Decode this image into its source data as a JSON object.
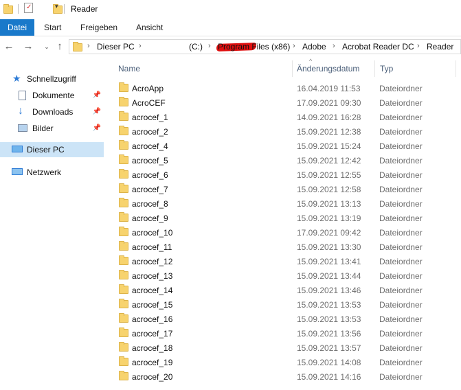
{
  "window": {
    "title": "Reader"
  },
  "ribbon": {
    "tabs": [
      "Datei",
      "Start",
      "Freigeben",
      "Ansicht"
    ]
  },
  "address": {
    "crumbs": [
      "Dieser PC",
      "(C:)",
      "Program Files (x86)",
      "Adobe",
      "Acrobat Reader DC",
      "Reader"
    ]
  },
  "sidebar": {
    "quick_access": "Schnellzugriff",
    "items": [
      "Dokumente",
      "Downloads",
      "Bilder"
    ],
    "this_pc": "Dieser PC",
    "network": "Netzwerk"
  },
  "columns": {
    "name": "Name",
    "date": "Änderungsdatum",
    "type": "Typ"
  },
  "files": [
    {
      "name": "AcroApp",
      "date": "16.04.2019 11:53",
      "type": "Dateiordner"
    },
    {
      "name": "AcroCEF",
      "date": "17.09.2021 09:30",
      "type": "Dateiordner"
    },
    {
      "name": "acrocef_1",
      "date": "14.09.2021 16:28",
      "type": "Dateiordner"
    },
    {
      "name": "acrocef_2",
      "date": "15.09.2021 12:38",
      "type": "Dateiordner"
    },
    {
      "name": "acrocef_4",
      "date": "15.09.2021 15:24",
      "type": "Dateiordner"
    },
    {
      "name": "acrocef_5",
      "date": "15.09.2021 12:42",
      "type": "Dateiordner"
    },
    {
      "name": "acrocef_6",
      "date": "15.09.2021 12:55",
      "type": "Dateiordner"
    },
    {
      "name": "acrocef_7",
      "date": "15.09.2021 12:58",
      "type": "Dateiordner"
    },
    {
      "name": "acrocef_8",
      "date": "15.09.2021 13:13",
      "type": "Dateiordner"
    },
    {
      "name": "acrocef_9",
      "date": "15.09.2021 13:19",
      "type": "Dateiordner"
    },
    {
      "name": "acrocef_10",
      "date": "17.09.2021 09:42",
      "type": "Dateiordner"
    },
    {
      "name": "acrocef_11",
      "date": "15.09.2021 13:30",
      "type": "Dateiordner"
    },
    {
      "name": "acrocef_12",
      "date": "15.09.2021 13:41",
      "type": "Dateiordner"
    },
    {
      "name": "acrocef_13",
      "date": "15.09.2021 13:44",
      "type": "Dateiordner"
    },
    {
      "name": "acrocef_14",
      "date": "15.09.2021 13:46",
      "type": "Dateiordner"
    },
    {
      "name": "acrocef_15",
      "date": "15.09.2021 13:53",
      "type": "Dateiordner"
    },
    {
      "name": "acrocef_16",
      "date": "15.09.2021 13:53",
      "type": "Dateiordner"
    },
    {
      "name": "acrocef_17",
      "date": "15.09.2021 13:56",
      "type": "Dateiordner"
    },
    {
      "name": "acrocef_18",
      "date": "15.09.2021 13:57",
      "type": "Dateiordner"
    },
    {
      "name": "acrocef_19",
      "date": "15.09.2021 14:08",
      "type": "Dateiordner"
    },
    {
      "name": "acrocef_20",
      "date": "15.09.2021 14:16",
      "type": "Dateiordner"
    }
  ],
  "colors": {
    "ribbon_file_tab": "#1979ca",
    "selection": "#cce4f7",
    "folder": "#f7d36e"
  }
}
